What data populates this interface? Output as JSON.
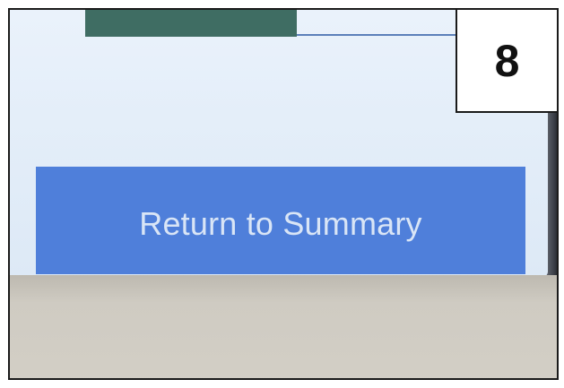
{
  "step_badge": {
    "number": "8"
  },
  "screen": {
    "return_button_label": "Return to Summary"
  },
  "colors": {
    "button_fill": "#4f7fda",
    "button_text": "#d9e5f6",
    "screen_background": "#e4eef9",
    "top_panel": "#3f6d63",
    "housing": "#cfcbc2"
  }
}
